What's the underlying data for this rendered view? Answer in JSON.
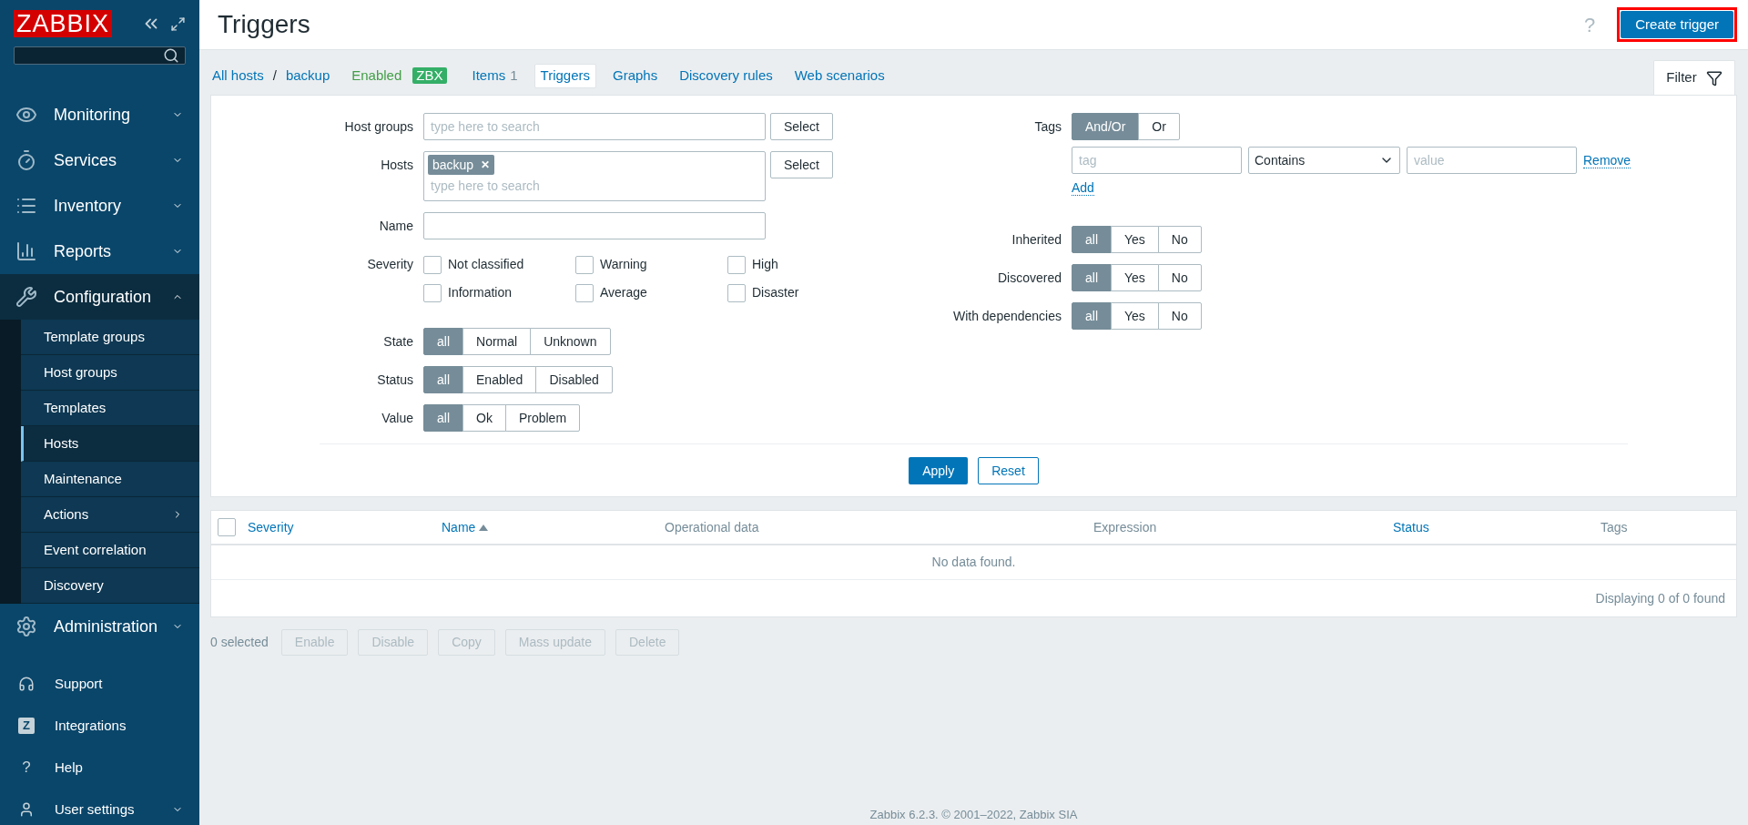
{
  "sidebar": {
    "logo": "ZABBIX",
    "menu": [
      {
        "label": "Monitoring",
        "expanded": false
      },
      {
        "label": "Services",
        "expanded": false
      },
      {
        "label": "Inventory",
        "expanded": false
      },
      {
        "label": "Reports",
        "expanded": false
      },
      {
        "label": "Configuration",
        "expanded": true,
        "children": [
          {
            "label": "Template groups",
            "selected": false,
            "submenu": false
          },
          {
            "label": "Host groups",
            "selected": false,
            "submenu": false
          },
          {
            "label": "Templates",
            "selected": false,
            "submenu": false
          },
          {
            "label": "Hosts",
            "selected": true,
            "submenu": false
          },
          {
            "label": "Maintenance",
            "selected": false,
            "submenu": false
          },
          {
            "label": "Actions",
            "selected": false,
            "submenu": true
          },
          {
            "label": "Event correlation",
            "selected": false,
            "submenu": false
          },
          {
            "label": "Discovery",
            "selected": false,
            "submenu": false
          }
        ]
      },
      {
        "label": "Administration",
        "expanded": false
      }
    ],
    "bottom": [
      {
        "label": "Support",
        "expandable": false
      },
      {
        "label": "Integrations",
        "glyph": "Z",
        "expandable": false
      },
      {
        "label": "Help",
        "glyph": "?",
        "expandable": false
      },
      {
        "label": "User settings",
        "expandable": true
      }
    ]
  },
  "header": {
    "title": "Triggers",
    "help": "?",
    "create_button": {
      "label": "Create trigger",
      "highlighted": true
    }
  },
  "nav": {
    "breadcrumbs": [
      "All hosts",
      "backup"
    ],
    "separator": "/",
    "status": "Enabled",
    "badge": "ZBX",
    "tabs": [
      {
        "label": "Items",
        "count": "1",
        "selected": false
      },
      {
        "label": "Triggers",
        "selected": true
      },
      {
        "label": "Graphs",
        "selected": false
      },
      {
        "label": "Discovery rules",
        "selected": false
      },
      {
        "label": "Web scenarios",
        "selected": false
      }
    ],
    "filter_tab": {
      "label": "Filter",
      "selected": true
    }
  },
  "filter": {
    "host_groups": {
      "label": "Host groups",
      "placeholder": "type here to search",
      "button": "Select"
    },
    "hosts": {
      "label": "Hosts",
      "chips": [
        "backup"
      ],
      "chip_remove": "✕",
      "placeholder": "type here to search",
      "button": "Select"
    },
    "name": {
      "label": "Name"
    },
    "severity": {
      "label": "Severity",
      "options": [
        {
          "label": "Not classified",
          "checked": false
        },
        {
          "label": "Warning",
          "checked": false
        },
        {
          "label": "High",
          "checked": false
        },
        {
          "label": "Information",
          "checked": false
        },
        {
          "label": "Average",
          "checked": false
        },
        {
          "label": "Disaster",
          "checked": false
        }
      ]
    },
    "segments_left": [
      {
        "label": "State",
        "options": [
          {
            "label": "all",
            "selected": true
          },
          {
            "label": "Normal",
            "selected": false
          },
          {
            "label": "Unknown",
            "selected": false
          }
        ]
      },
      {
        "label": "Status",
        "options": [
          {
            "label": "all",
            "selected": true
          },
          {
            "label": "Enabled",
            "selected": false
          },
          {
            "label": "Disabled",
            "selected": false
          }
        ]
      },
      {
        "label": "Value",
        "options": [
          {
            "label": "all",
            "selected": true
          },
          {
            "label": "Ok",
            "selected": false
          },
          {
            "label": "Problem",
            "selected": false
          }
        ]
      }
    ],
    "tags": {
      "label": "Tags",
      "options": [
        {
          "label": "And/Or",
          "selected": true
        },
        {
          "label": "Or",
          "selected": false
        }
      ],
      "tag_placeholder": "tag",
      "operator": "Contains",
      "value_placeholder": "value",
      "remove": "Remove",
      "add": "Add"
    },
    "segments_right": [
      {
        "label": "Inherited",
        "options": [
          {
            "label": "all",
            "selected": true
          },
          {
            "label": "Yes",
            "selected": false
          },
          {
            "label": "No",
            "selected": false
          }
        ]
      },
      {
        "label": "Discovered",
        "options": [
          {
            "label": "all",
            "selected": true
          },
          {
            "label": "Yes",
            "selected": false
          },
          {
            "label": "No",
            "selected": false
          }
        ]
      },
      {
        "label": "With dependencies",
        "options": [
          {
            "label": "all",
            "selected": true
          },
          {
            "label": "Yes",
            "selected": false
          },
          {
            "label": "No",
            "selected": false
          }
        ]
      }
    ],
    "apply": "Apply",
    "reset": "Reset"
  },
  "table": {
    "select_all": false,
    "columns": [
      {
        "label": "Severity",
        "sortable": true,
        "sorted": false
      },
      {
        "label": "Name",
        "sortable": true,
        "sorted": true
      },
      {
        "label": "Operational data",
        "sortable": false,
        "sorted": false
      },
      {
        "label": "Expression",
        "sortable": false,
        "sorted": false
      },
      {
        "label": "Status",
        "sortable": true,
        "sorted": false
      },
      {
        "label": "Tags",
        "sortable": false,
        "sorted": false
      }
    ],
    "empty": "No data found.",
    "summary": "Displaying 0 of 0 found"
  },
  "actions": {
    "selected_count": "0 selected",
    "buttons": [
      {
        "label": "Enable",
        "disabled": true
      },
      {
        "label": "Disable",
        "disabled": true
      },
      {
        "label": "Copy",
        "disabled": true
      },
      {
        "label": "Mass update",
        "disabled": true
      },
      {
        "label": "Delete",
        "disabled": true
      }
    ]
  },
  "footer": "Zabbix 6.2.3. © 2001–2022, Zabbix SIA"
}
